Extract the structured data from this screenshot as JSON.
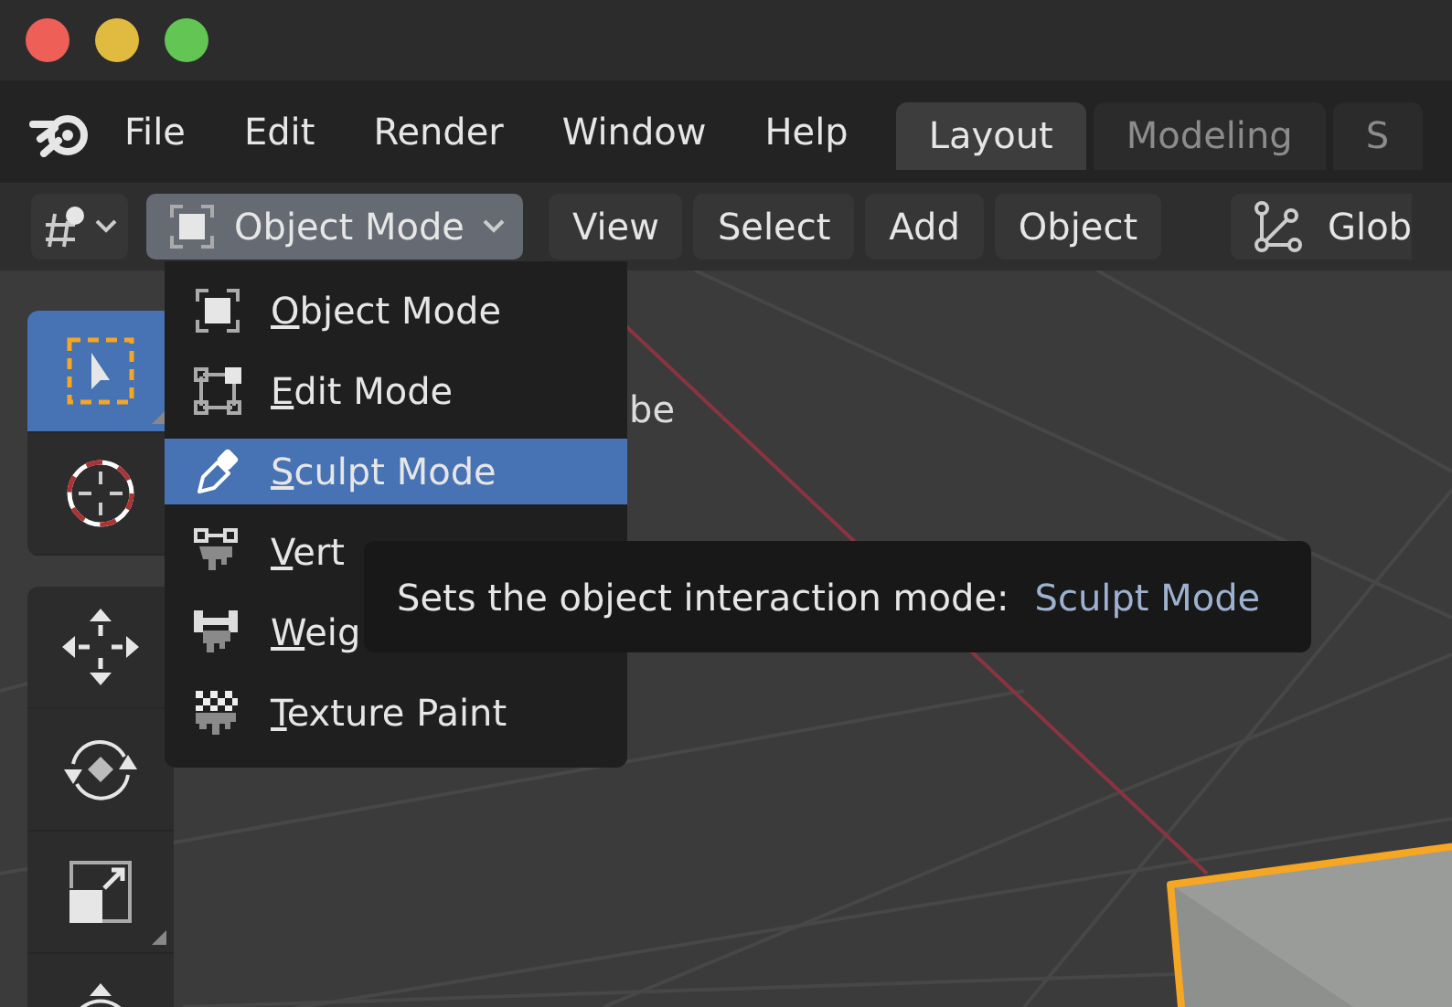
{
  "window_controls": [
    {
      "color": "#ed5f57"
    },
    {
      "color": "#e0bb3f"
    },
    {
      "color": "#62c554"
    }
  ],
  "menu_bar": {
    "items": [
      "File",
      "Edit",
      "Render",
      "Window",
      "Help"
    ]
  },
  "workspace_tabs": [
    {
      "label": "Layout",
      "selected": true
    },
    {
      "label": "Modeling",
      "selected": false
    },
    {
      "label": "S",
      "selected": false
    }
  ],
  "header": {
    "mode_dropdown": {
      "label": "Object Mode",
      "expanded": true
    },
    "menus": [
      "View",
      "Select",
      "Add",
      "Object"
    ],
    "orientation": {
      "label": "Glob"
    }
  },
  "toolbar": {
    "groups": [
      [
        {
          "kind": "select_box",
          "selected": true
        },
        {
          "kind": "cursor",
          "selected": false
        }
      ],
      [
        {
          "kind": "move",
          "selected": false
        },
        {
          "kind": "rotate",
          "selected": false
        },
        {
          "kind": "scale",
          "selected": false
        },
        {
          "kind": "transform",
          "selected": false
        }
      ]
    ]
  },
  "viewport": {
    "overlay_lines": [
      "be"
    ]
  },
  "mode_menu": {
    "items": [
      {
        "kind": "object",
        "label": "Object Mode",
        "selected": false
      },
      {
        "kind": "edit",
        "label": "Edit Mode",
        "selected": false
      },
      {
        "kind": "sculpt",
        "label": "Sculpt Mode",
        "selected": true
      },
      {
        "kind": "vertex_paint",
        "label": "Vert",
        "selected": false
      },
      {
        "kind": "weight_paint",
        "label": "Weig",
        "selected": false
      },
      {
        "kind": "texture_paint",
        "label": "Texture Paint",
        "selected": false
      }
    ]
  },
  "tooltip": {
    "text": "Sets the object interaction mode:",
    "value": "Sculpt Mode"
  }
}
